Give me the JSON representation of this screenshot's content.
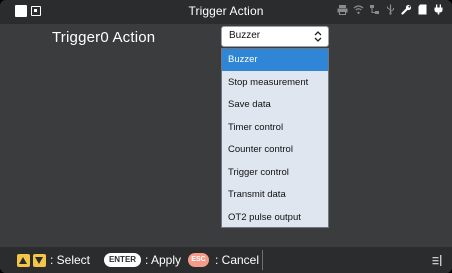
{
  "statusbar": {
    "title": "Trigger Action",
    "icons": [
      "printer-icon",
      "wifi-icon",
      "network-icon",
      "usb-icon",
      "tool-icon",
      "sd-card-icon",
      "power-icon"
    ]
  },
  "setting": {
    "label": "Trigger0 Action",
    "selected_value": "Buzzer"
  },
  "dropdown": {
    "options": [
      "Buzzer",
      "Stop measurement",
      "Save data",
      "Timer control",
      "Counter control",
      "Trigger control",
      "Transmit data",
      "OT2 pulse output"
    ],
    "selected_index": 0
  },
  "footer": {
    "select_label": ": Select",
    "enter_key": "ENTER",
    "apply_label": ": Apply",
    "esc_key": "ESC",
    "cancel_label": ": Cancel"
  },
  "colors": {
    "accent": "#2f86d6",
    "key_yellow": "#f3c64a",
    "key_esc": "#f59b8a",
    "background": "#3b3c3e",
    "bars": "#2b2c2e"
  }
}
